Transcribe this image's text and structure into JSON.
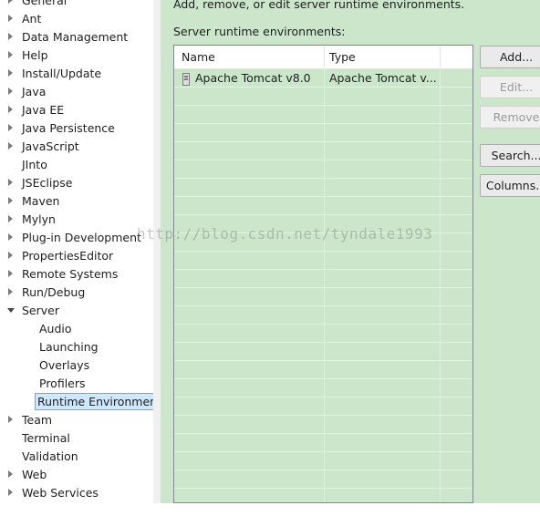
{
  "tree": {
    "items": [
      {
        "label": "General",
        "expandable": true
      },
      {
        "label": "Ant",
        "expandable": true
      },
      {
        "label": "Data Management",
        "expandable": true
      },
      {
        "label": "Help",
        "expandable": true
      },
      {
        "label": "Install/Update",
        "expandable": true
      },
      {
        "label": "Java",
        "expandable": true
      },
      {
        "label": "Java EE",
        "expandable": true
      },
      {
        "label": "Java Persistence",
        "expandable": true
      },
      {
        "label": "JavaScript",
        "expandable": true
      },
      {
        "label": "JInto",
        "expandable": false
      },
      {
        "label": "JSEclipse",
        "expandable": true
      },
      {
        "label": "Maven",
        "expandable": true
      },
      {
        "label": "Mylyn",
        "expandable": true
      },
      {
        "label": "Plug-in Development",
        "expandable": true
      },
      {
        "label": "PropertiesEditor",
        "expandable": true
      },
      {
        "label": "Remote Systems",
        "expandable": true
      },
      {
        "label": "Run/Debug",
        "expandable": true
      },
      {
        "label": "Server",
        "expandable": true,
        "expanded": true
      },
      {
        "label": "Audio",
        "child": true
      },
      {
        "label": "Launching",
        "child": true
      },
      {
        "label": "Overlays",
        "child": true
      },
      {
        "label": "Profilers",
        "child": true
      },
      {
        "label": "Runtime Environment",
        "child": true,
        "selected": true
      },
      {
        "label": "Team",
        "expandable": true
      },
      {
        "label": "Terminal",
        "expandable": false
      },
      {
        "label": "Validation",
        "expandable": false
      },
      {
        "label": "Web",
        "expandable": true
      },
      {
        "label": "Web Services",
        "expandable": true
      }
    ]
  },
  "panel": {
    "description": "Add, remove, or edit server runtime environments.",
    "list_label": "Server runtime environments:",
    "columns": [
      "Name",
      "Type"
    ],
    "rows": [
      {
        "name": "Apache Tomcat v8.0",
        "type": "Apache Tomcat v..."
      }
    ]
  },
  "buttons": {
    "add": "Add...",
    "edit": "Edit...",
    "remove": "Remove",
    "search": "Search...",
    "columns": "Columns..."
  },
  "watermark": "http://blog.csdn.net/tyndale1993",
  "colors": {
    "background_band": "#cbe6cb",
    "selection": "#cde8ff"
  }
}
